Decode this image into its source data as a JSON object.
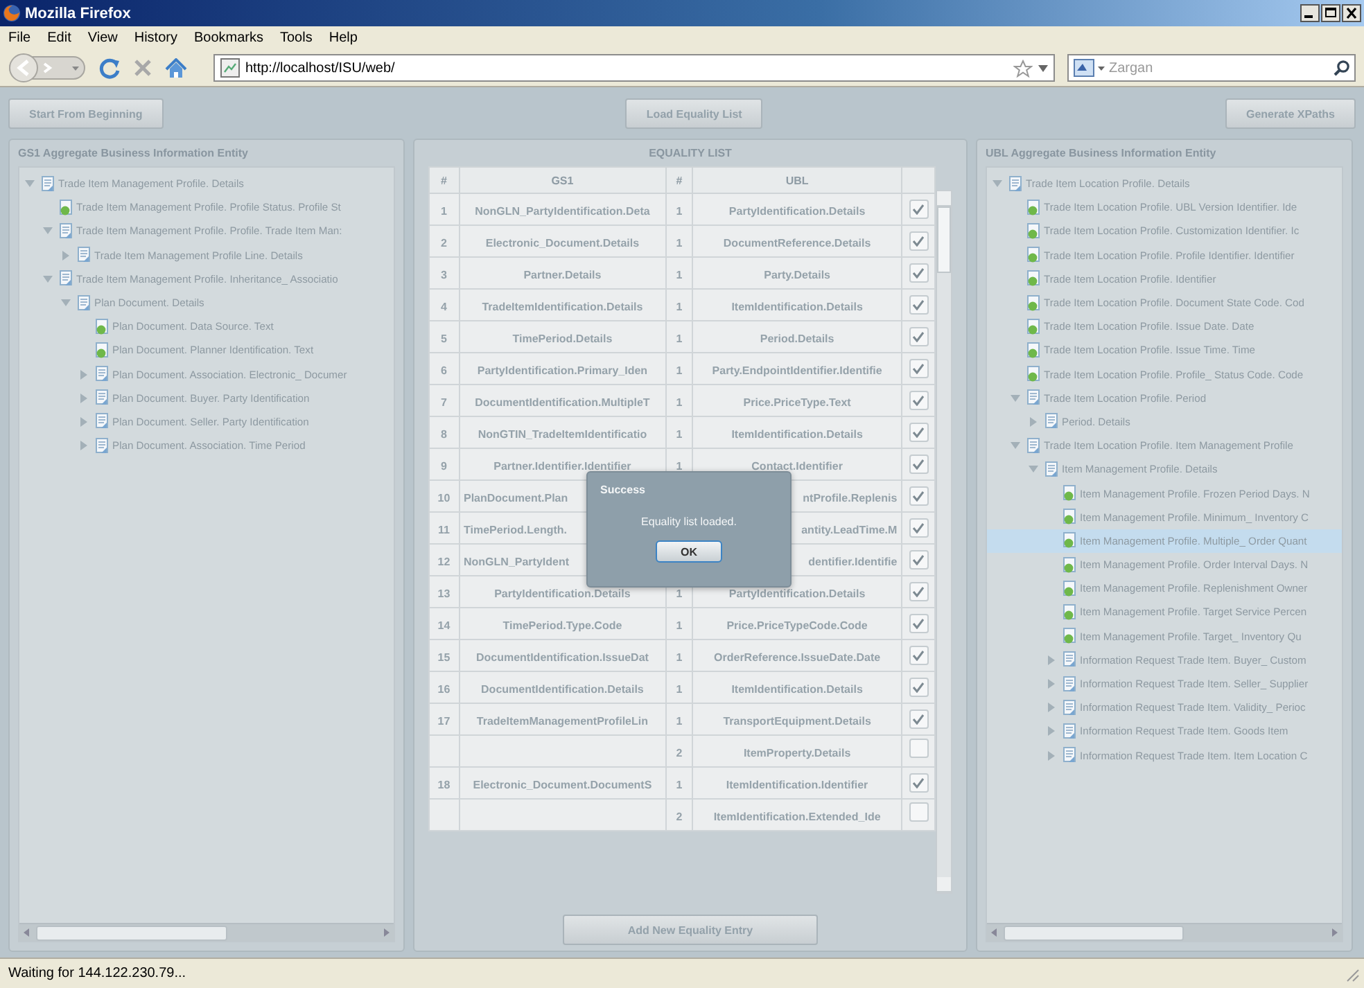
{
  "window": {
    "title": "Mozilla Firefox"
  },
  "menu": [
    "File",
    "Edit",
    "View",
    "History",
    "Bookmarks",
    "Tools",
    "Help"
  ],
  "navigation": {
    "url": "http://localhost/ISU/web/",
    "search": {
      "placeholder": "Zargan"
    }
  },
  "actions": [
    "Start From Beginning",
    "Load Equality List",
    "Generate XPaths"
  ],
  "left_panel": {
    "title": "GS1 Aggregate Business Information Entity",
    "tree": [
      {
        "label": "Trade Item Management Profile. Details",
        "kind": "branch",
        "expanded": true,
        "selected": false,
        "children": [
          {
            "label": "Trade Item Management Profile. Profile Status. Profile St",
            "kind": "leaf",
            "selected": false
          },
          {
            "label": "Trade Item Management Profile. Profile. Trade Item Man:",
            "kind": "branch",
            "expanded": true,
            "selected": false,
            "children": [
              {
                "label": "Trade Item Management Profile Line. Details",
                "kind": "branch",
                "expanded": false,
                "selected": false
              }
            ]
          },
          {
            "label": "Trade Item Management Profile. Inheritance_ Associatio",
            "kind": "branch",
            "expanded": true,
            "selected": false,
            "children": [
              {
                "label": "Plan Document. Details",
                "kind": "branch",
                "expanded": true,
                "selected": false,
                "children": [
                  {
                    "label": "Plan Document. Data Source. Text",
                    "kind": "leaf",
                    "selected": false
                  },
                  {
                    "label": "Plan Document. Planner Identification. Text",
                    "kind": "leaf",
                    "selected": false
                  },
                  {
                    "label": "Plan Document. Association. Electronic_ Documer",
                    "kind": "branch",
                    "expanded": false,
                    "selected": false
                  },
                  {
                    "label": "Plan Document. Buyer. Party Identification",
                    "kind": "branch",
                    "expanded": false,
                    "selected": false
                  },
                  {
                    "label": "Plan Document. Seller. Party Identification",
                    "kind": "branch",
                    "expanded": false,
                    "selected": false
                  },
                  {
                    "label": "Plan Document. Association. Time Period",
                    "kind": "branch",
                    "expanded": false,
                    "selected": false
                  }
                ]
              }
            ]
          }
        ]
      }
    ]
  },
  "equality_list": {
    "title": "EQUALITY LIST",
    "columns": [
      "#",
      "GS1",
      "#",
      "UBL"
    ],
    "rows": [
      {
        "number": "1",
        "gs1": "NonGLN_PartyIdentification.Deta",
        "ubl_number": "1",
        "ubl": "PartyIdentification.Details",
        "checked": true
      },
      {
        "number": "2",
        "gs1": "Electronic_Document.Details",
        "ubl_number": "1",
        "ubl": "DocumentReference.Details",
        "checked": true
      },
      {
        "number": "3",
        "gs1": "Partner.Details",
        "ubl_number": "1",
        "ubl": "Party.Details",
        "checked": true
      },
      {
        "number": "4",
        "gs1": "TradeItemIdentification.Details",
        "ubl_number": "1",
        "ubl": "ItemIdentification.Details",
        "checked": true
      },
      {
        "number": "5",
        "gs1": "TimePeriod.Details",
        "ubl_number": "1",
        "ubl": "Period.Details",
        "checked": true
      },
      {
        "number": "6",
        "gs1": "PartyIdentification.Primary_Iden",
        "ubl_number": "1",
        "ubl": "Party.EndpointIdentifier.Identifie",
        "checked": true
      },
      {
        "number": "7",
        "gs1": "DocumentIdentification.MultipleT",
        "ubl_number": "1",
        "ubl": "Price.PriceType.Text",
        "checked": true
      },
      {
        "number": "8",
        "gs1": "NonGTIN_TradeItemIdentificatio",
        "ubl_number": "1",
        "ubl": "ItemIdentification.Details",
        "checked": true
      },
      {
        "number": "9",
        "gs1": "Partner.Identifier.Identifier",
        "ubl_number": "1",
        "ubl": "Contact.Identifier",
        "checked": true
      },
      {
        "number": "10",
        "gs1": "PlanDocument.Plan",
        "ubl": "ntProfile.Replenis",
        "checked": true,
        "covered": true
      },
      {
        "number": "11",
        "gs1": "TimePeriod.Length.",
        "ubl": "antity.LeadTime.M",
        "checked": true,
        "covered": true
      },
      {
        "number": "12",
        "gs1": "NonGLN_PartyIdent",
        "ubl": "dentifier.Identifie",
        "checked": true,
        "covered": true
      },
      {
        "number": "13",
        "gs1": "PartyIdentification.Details",
        "ubl_number": "1",
        "ubl": "PartyIdentification.Details",
        "checked": true
      },
      {
        "number": "14",
        "gs1": "TimePeriod.Type.Code",
        "ubl_number": "1",
        "ubl": "Price.PriceTypeCode.Code",
        "checked": true
      },
      {
        "number": "15",
        "gs1": "DocumentIdentification.IssueDat",
        "ubl_number": "1",
        "ubl": "OrderReference.IssueDate.Date",
        "checked": true
      },
      {
        "number": "16",
        "gs1": "DocumentIdentification.Details",
        "ubl_number": "1",
        "ubl": "ItemIdentification.Details",
        "checked": true
      },
      {
        "number": "17",
        "gs1": "TradeItemManagementProfileLin",
        "ubl_number": "1",
        "ubl": "TransportEquipment.Details",
        "checked": true
      },
      {
        "ubl_number": "2",
        "ubl": "ItemProperty.Details",
        "checked": false
      },
      {
        "number": "18",
        "gs1": "Electronic_Document.DocumentS",
        "ubl_number": "1",
        "ubl": "ItemIdentification.Identifier",
        "checked": true
      },
      {
        "ubl_number": "2",
        "ubl": "ItemIdentification.Extended_Ide",
        "checked": false
      }
    ],
    "add_button": "Add New Equality Entry"
  },
  "right_panel": {
    "title": "UBL Aggregate Business Information Entity",
    "tree": [
      {
        "label": "Trade Item Location Profile. Details",
        "kind": "branch",
        "expanded": true,
        "selected": false,
        "children": [
          {
            "label": "Trade Item Location Profile. UBL Version Identifier. Ide",
            "kind": "leaf",
            "selected": false
          },
          {
            "label": "Trade Item Location Profile. Customization Identifier. Ic",
            "kind": "leaf",
            "selected": false
          },
          {
            "label": "Trade Item Location Profile. Profile Identifier. Identifier",
            "kind": "leaf",
            "selected": false
          },
          {
            "label": "Trade Item Location Profile. Identifier",
            "kind": "leaf",
            "selected": false
          },
          {
            "label": "Trade Item Location Profile. Document State Code. Cod",
            "kind": "leaf",
            "selected": false
          },
          {
            "label": "Trade Item Location Profile. Issue Date. Date",
            "kind": "leaf",
            "selected": false
          },
          {
            "label": "Trade Item Location Profile. Issue Time. Time",
            "kind": "leaf",
            "selected": false
          },
          {
            "label": "Trade Item Location Profile. Profile_ Status Code. Code",
            "kind": "leaf",
            "selected": false
          },
          {
            "label": "Trade Item Location Profile. Period",
            "kind": "branch",
            "expanded": true,
            "selected": false,
            "children": [
              {
                "label": "Period. Details",
                "kind": "branch",
                "expanded": false,
                "selected": false
              }
            ]
          },
          {
            "label": "Trade Item Location Profile. Item Management Profile",
            "kind": "branch",
            "expanded": true,
            "selected": false,
            "children": [
              {
                "label": "Item Management Profile. Details",
                "kind": "branch",
                "expanded": true,
                "selected": false,
                "children": [
                  {
                    "label": "Item Management Profile. Frozen Period Days. N",
                    "kind": "leaf",
                    "selected": false
                  },
                  {
                    "label": "Item Management Profile. Minimum_ Inventory C",
                    "kind": "leaf",
                    "selected": false
                  },
                  {
                    "label": "Item Management Profile. Multiple_ Order Quant",
                    "kind": "leaf",
                    "selected": true
                  },
                  {
                    "label": "Item Management Profile. Order Interval Days. N",
                    "kind": "leaf",
                    "selected": false
                  },
                  {
                    "label": "Item Management Profile. Replenishment Owner",
                    "kind": "leaf",
                    "selected": false
                  },
                  {
                    "label": "Item Management Profile. Target Service Percen",
                    "kind": "leaf",
                    "selected": false
                  },
                  {
                    "label": "Item Management Profile. Target_ Inventory Qu",
                    "kind": "leaf",
                    "selected": false
                  },
                  {
                    "label": "Information Request Trade Item. Buyer_ Custom",
                    "kind": "branch",
                    "expanded": false,
                    "selected": false
                  },
                  {
                    "label": "Information Request Trade Item. Seller_ Supplier",
                    "kind": "branch",
                    "expanded": false,
                    "selected": false
                  },
                  {
                    "label": "Information Request Trade Item. Validity_ Perioc",
                    "kind": "branch",
                    "expanded": false,
                    "selected": false
                  },
                  {
                    "label": "Information Request Trade Item. Goods Item",
                    "kind": "branch",
                    "expanded": false,
                    "selected": false
                  },
                  {
                    "label": "Information Request Trade Item. Item Location C",
                    "kind": "branch",
                    "expanded": false,
                    "selected": false
                  }
                ]
              }
            ]
          }
        ]
      }
    ]
  },
  "dialog": {
    "title": "Success",
    "message": "Equality list loaded.",
    "button": "OK"
  },
  "status_bar": "Waiting for 144.122.230.79..."
}
